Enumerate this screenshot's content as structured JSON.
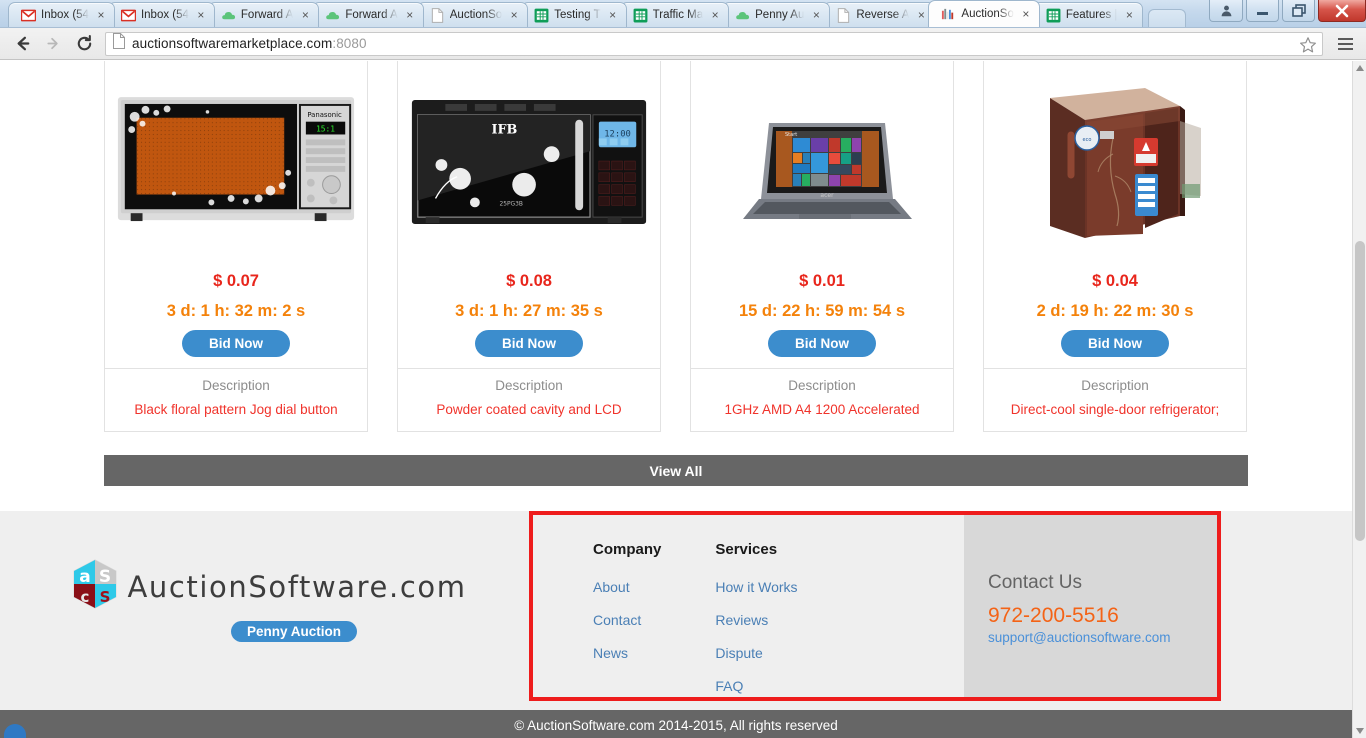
{
  "browser": {
    "tabs": [
      {
        "title": "Inbox (54",
        "icon": "gmail-icon",
        "active": false
      },
      {
        "title": "Inbox (54",
        "icon": "gmail-icon",
        "active": false
      },
      {
        "title": "Forward A",
        "icon": "cloud-icon",
        "active": false
      },
      {
        "title": "Forward A",
        "icon": "cloud-icon",
        "active": false
      },
      {
        "title": "AuctionSo",
        "icon": "document-icon",
        "active": false
      },
      {
        "title": "Testing T",
        "icon": "sheets-icon",
        "active": false
      },
      {
        "title": "Traffic Ma",
        "icon": "sheets-icon",
        "active": false
      },
      {
        "title": "Penny Au",
        "icon": "cloud-icon",
        "active": false
      },
      {
        "title": "Reverse A",
        "icon": "document-icon",
        "active": false
      },
      {
        "title": "AuctionSo",
        "icon": "auction-favicon",
        "active": true
      },
      {
        "title": "Features |",
        "icon": "sheets-icon",
        "active": false
      }
    ],
    "tab_close_label": "×",
    "window_controls": {
      "person_label": "person-icon",
      "minimize_label": "minimize-icon",
      "restore_label": "restore-icon",
      "close_label": "close-icon"
    },
    "toolbar": {
      "back_label": "back-arrow-icon",
      "forward_label": "forward-arrow-icon",
      "reload_label": "reload-icon",
      "url_host": "auctionsoftwaremarketplace.com",
      "url_port": ":8080",
      "star_label": "bookmark-star-icon",
      "menu_label": "hamburger-menu-icon"
    }
  },
  "products": [
    {
      "image_alt": "panasonic-microwave-floral",
      "price": "$ 0.07",
      "timer": "3 d: 1 h: 32 m: 2 s",
      "bid_label": "Bid Now",
      "desc_label": "Description",
      "desc_text": "Black floral pattern Jog dial button"
    },
    {
      "image_alt": "ifb-microwave-floral",
      "price": "$ 0.08",
      "timer": "3 d: 1 h: 27 m: 35 s",
      "bid_label": "Bid Now",
      "desc_label": "Description",
      "desc_text": "Powder coated cavity and LCD"
    },
    {
      "image_alt": "acer-laptop-windows8",
      "price": "$ 0.01",
      "timer": "15 d: 22 h: 59 m: 54 s",
      "bid_label": "Bid Now",
      "desc_label": "Description",
      "desc_text": "1GHz AMD A4 1200 Accelerated"
    },
    {
      "image_alt": "brown-single-door-refrigerator",
      "price": "$ 0.04",
      "timer": "2 d: 19 h: 22 m: 30 s",
      "bid_label": "Bid Now",
      "desc_label": "Description",
      "desc_text": "Direct-cool single-door refrigerator;"
    }
  ],
  "view_all_label": "View All",
  "footer": {
    "logo_text": "AuctionSoftware.com",
    "logo_tagline": "Penny Auction",
    "company": {
      "title": "Company",
      "links": [
        "About",
        "Contact",
        "News"
      ]
    },
    "services": {
      "title": "Services",
      "links": [
        "How it Works",
        "Reviews",
        "Dispute",
        "FAQ"
      ]
    },
    "contact": {
      "title": "Contact Us",
      "phone": "972-200-5516",
      "email": "support@auctionsoftware.com"
    }
  },
  "copyright": "© AuctionSoftware.com 2014-2015, All rights reserved",
  "colors": {
    "price_red": "#e8261c",
    "timer_orange": "#f4820b",
    "bid_blue": "#3c8dcd",
    "desc_red": "#f0332b",
    "highlight_red": "#ee1c1c",
    "footer_gray": "#666666",
    "link_blue": "#4a7fb5",
    "phone_orange": "#f46316"
  }
}
